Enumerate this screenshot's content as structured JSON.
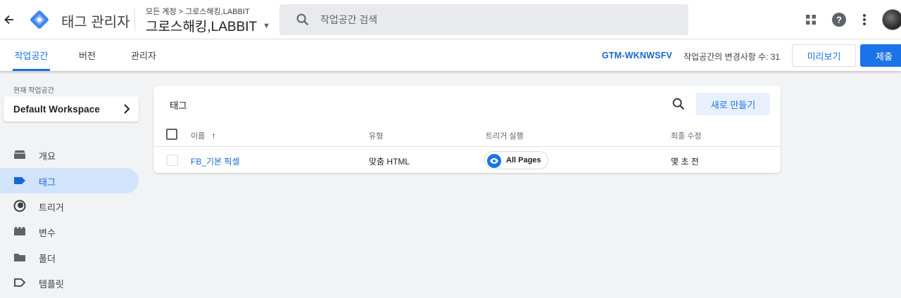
{
  "topbar": {
    "app_title": "태그 관리자",
    "breadcrumb": "모든 계정 > 그로스해킹,LABBIT",
    "container_name": "그로스해킹,LABBIT",
    "search_placeholder": "작업공간 검색",
    "icons": [
      "back-arrow-icon",
      "gtm-logo-icon",
      "caret-down-icon",
      "search-icon",
      "apps-grid-icon",
      "help-icon",
      "more-vert-icon",
      "avatar"
    ],
    "logo_colors": {
      "primary": "#4285f4",
      "secondary": "#8ab4f8"
    }
  },
  "tabs": [
    {
      "label": "작업공간",
      "active": true
    },
    {
      "label": "버전",
      "active": false
    },
    {
      "label": "관리자",
      "active": false
    }
  ],
  "status": {
    "container_id": "GTM-WKNWSFV",
    "changes_text": "작업공간의 변경사항 수: 31"
  },
  "actions": {
    "preview_label": "미리보기",
    "submit_label": "제출"
  },
  "sidebar": {
    "workspace_label": "현재 작업공간",
    "workspace_name": "Default Workspace",
    "items": [
      {
        "label": "개요",
        "icon": "overview-icon",
        "active": false
      },
      {
        "label": "태그",
        "icon": "tag-icon",
        "active": true
      },
      {
        "label": "트리거",
        "icon": "trigger-icon",
        "active": false
      },
      {
        "label": "변수",
        "icon": "variable-icon",
        "active": false
      },
      {
        "label": "폴더",
        "icon": "folder-icon",
        "active": false
      },
      {
        "label": "템플릿",
        "icon": "template-icon",
        "active": false
      }
    ]
  },
  "tags_card": {
    "title": "태그",
    "new_button_label": "새로 만들기",
    "columns": {
      "name": "이름",
      "type": "유형",
      "trigger": "트리거 실행",
      "modified": "최종 수정"
    },
    "sort_indicator": "↑",
    "rows": [
      {
        "name": "FB_기본 픽셀",
        "type": "맞춤 HTML",
        "trigger": "All Pages",
        "modified": "몇 초 전"
      }
    ]
  },
  "colors": {
    "accent": "#1a73e8",
    "active_nav_bg": "#d2e3fc",
    "page_bg": "#f1f3f4"
  }
}
